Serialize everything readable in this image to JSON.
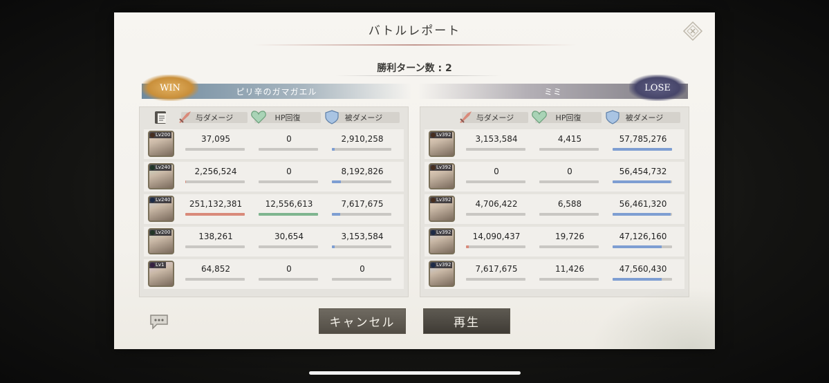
{
  "dialog": {
    "title": "バトルレポート",
    "turns_label": "勝利ターン数 : 2"
  },
  "left_team": {
    "badge": "WIN",
    "name": "ピリ辛のガマガエル",
    "headers": {
      "damage": "与ダメージ",
      "heal": "HP回復",
      "taken": "被ダメージ"
    },
    "rows": [
      {
        "level": "Lv200",
        "element_color": "#e07b2a",
        "damage": "37,095",
        "heal": "0",
        "taken": "2,910,258",
        "damage_frac": 0.0,
        "heal_frac": 0.0,
        "taken_frac": 0.05
      },
      {
        "level": "Lv240",
        "element_color": "#4a9a48",
        "damage": "2,256,524",
        "heal": "0",
        "taken": "8,192,826",
        "damage_frac": 0.01,
        "heal_frac": 0.0,
        "taken_frac": 0.15
      },
      {
        "level": "Lv240",
        "element_color": "#3b6fc4",
        "damage": "251,132,381",
        "heal": "12,556,613",
        "taken": "7,617,675",
        "damage_frac": 1.0,
        "heal_frac": 1.0,
        "taken_frac": 0.14
      },
      {
        "level": "Lv200",
        "element_color": "#4a9a48",
        "damage": "138,261",
        "heal": "30,654",
        "taken": "3,153,584",
        "damage_frac": 0.0,
        "heal_frac": 0.0,
        "taken_frac": 0.05
      },
      {
        "level": "Lv1",
        "element_color": "#9a4ab0",
        "damage": "64,852",
        "heal": "0",
        "taken": "0",
        "damage_frac": 0.0,
        "heal_frac": 0.0,
        "taken_frac": 0.0
      }
    ]
  },
  "right_team": {
    "badge": "LOSE",
    "name": "ミミ",
    "headers": {
      "damage": "与ダメージ",
      "heal": "HP回復",
      "taken": "被ダメージ"
    },
    "rows": [
      {
        "level": "Lv392",
        "element_color": "#e07b2a",
        "damage": "3,153,584",
        "heal": "4,415",
        "taken": "57,785,276",
        "damage_frac": 0.0,
        "heal_frac": 0.0,
        "taken_frac": 1.0
      },
      {
        "level": "Lv392",
        "element_color": "#e07b2a",
        "damage": "0",
        "heal": "0",
        "taken": "56,454,732",
        "damage_frac": 0.0,
        "heal_frac": 0.0,
        "taken_frac": 0.98
      },
      {
        "level": "Lv392",
        "element_color": "#e07b2a",
        "damage": "4,706,422",
        "heal": "6,588",
        "taken": "56,461,320",
        "damage_frac": 0.0,
        "heal_frac": 0.0,
        "taken_frac": 0.98
      },
      {
        "level": "Lv392",
        "element_color": "#3b6fc4",
        "damage": "14,090,437",
        "heal": "19,726",
        "taken": "47,126,160",
        "damage_frac": 0.05,
        "heal_frac": 0.0,
        "taken_frac": 0.82
      },
      {
        "level": "Lv392",
        "element_color": "#3b6fc4",
        "damage": "7,617,675",
        "heal": "11,426",
        "taken": "47,560,430",
        "damage_frac": 0.0,
        "heal_frac": 0.0,
        "taken_frac": 0.82
      }
    ]
  },
  "buttons": {
    "cancel": "キャンセル",
    "play": "再生"
  },
  "icons": {
    "close": "close-diamond-icon",
    "chat": "chat-bubble-icon",
    "log": "document-stack-icon",
    "damage": "sword-icon",
    "heal": "heart-icon",
    "taken": "shield-icon"
  },
  "colors": {
    "damage_bar": "#d98a7a",
    "heal_bar": "#7fb58f",
    "taken_bar": "#7e9ed2"
  }
}
